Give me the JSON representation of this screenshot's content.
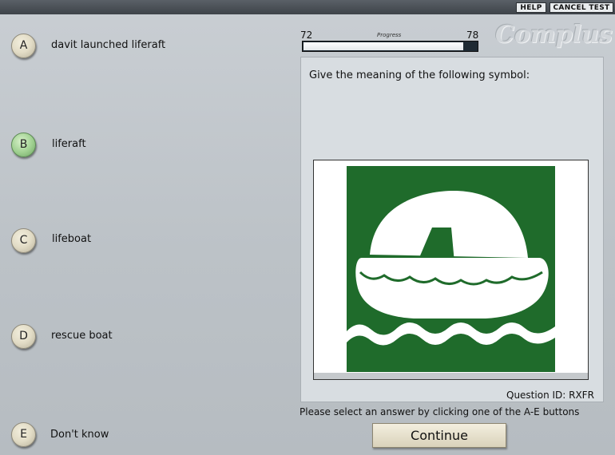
{
  "toolbar": {
    "help": "HELP",
    "cancel": "CANCEL TEST"
  },
  "options": [
    {
      "letter": "A",
      "text": "davit launched liferaft",
      "selected": false
    },
    {
      "letter": "B",
      "text": "liferaft",
      "selected": true
    },
    {
      "letter": "C",
      "text": "lifeboat",
      "selected": false
    },
    {
      "letter": "D",
      "text": "rescue boat",
      "selected": false
    },
    {
      "letter": "E",
      "text": "Don't know",
      "selected": false
    }
  ],
  "progress": {
    "current": "72",
    "total": "78",
    "label": "Progress",
    "fraction": 0.92
  },
  "logo": "Complus",
  "question": {
    "text": "Give the meaning of the following symbol:",
    "id_text": "Question ID: RXFR",
    "symbol_icon": "liferaft-symbol-icon",
    "symbol_color": "#1f6b2b"
  },
  "instruction": "Please select an answer by clicking one of the A-E buttons",
  "continue_label": "Continue"
}
